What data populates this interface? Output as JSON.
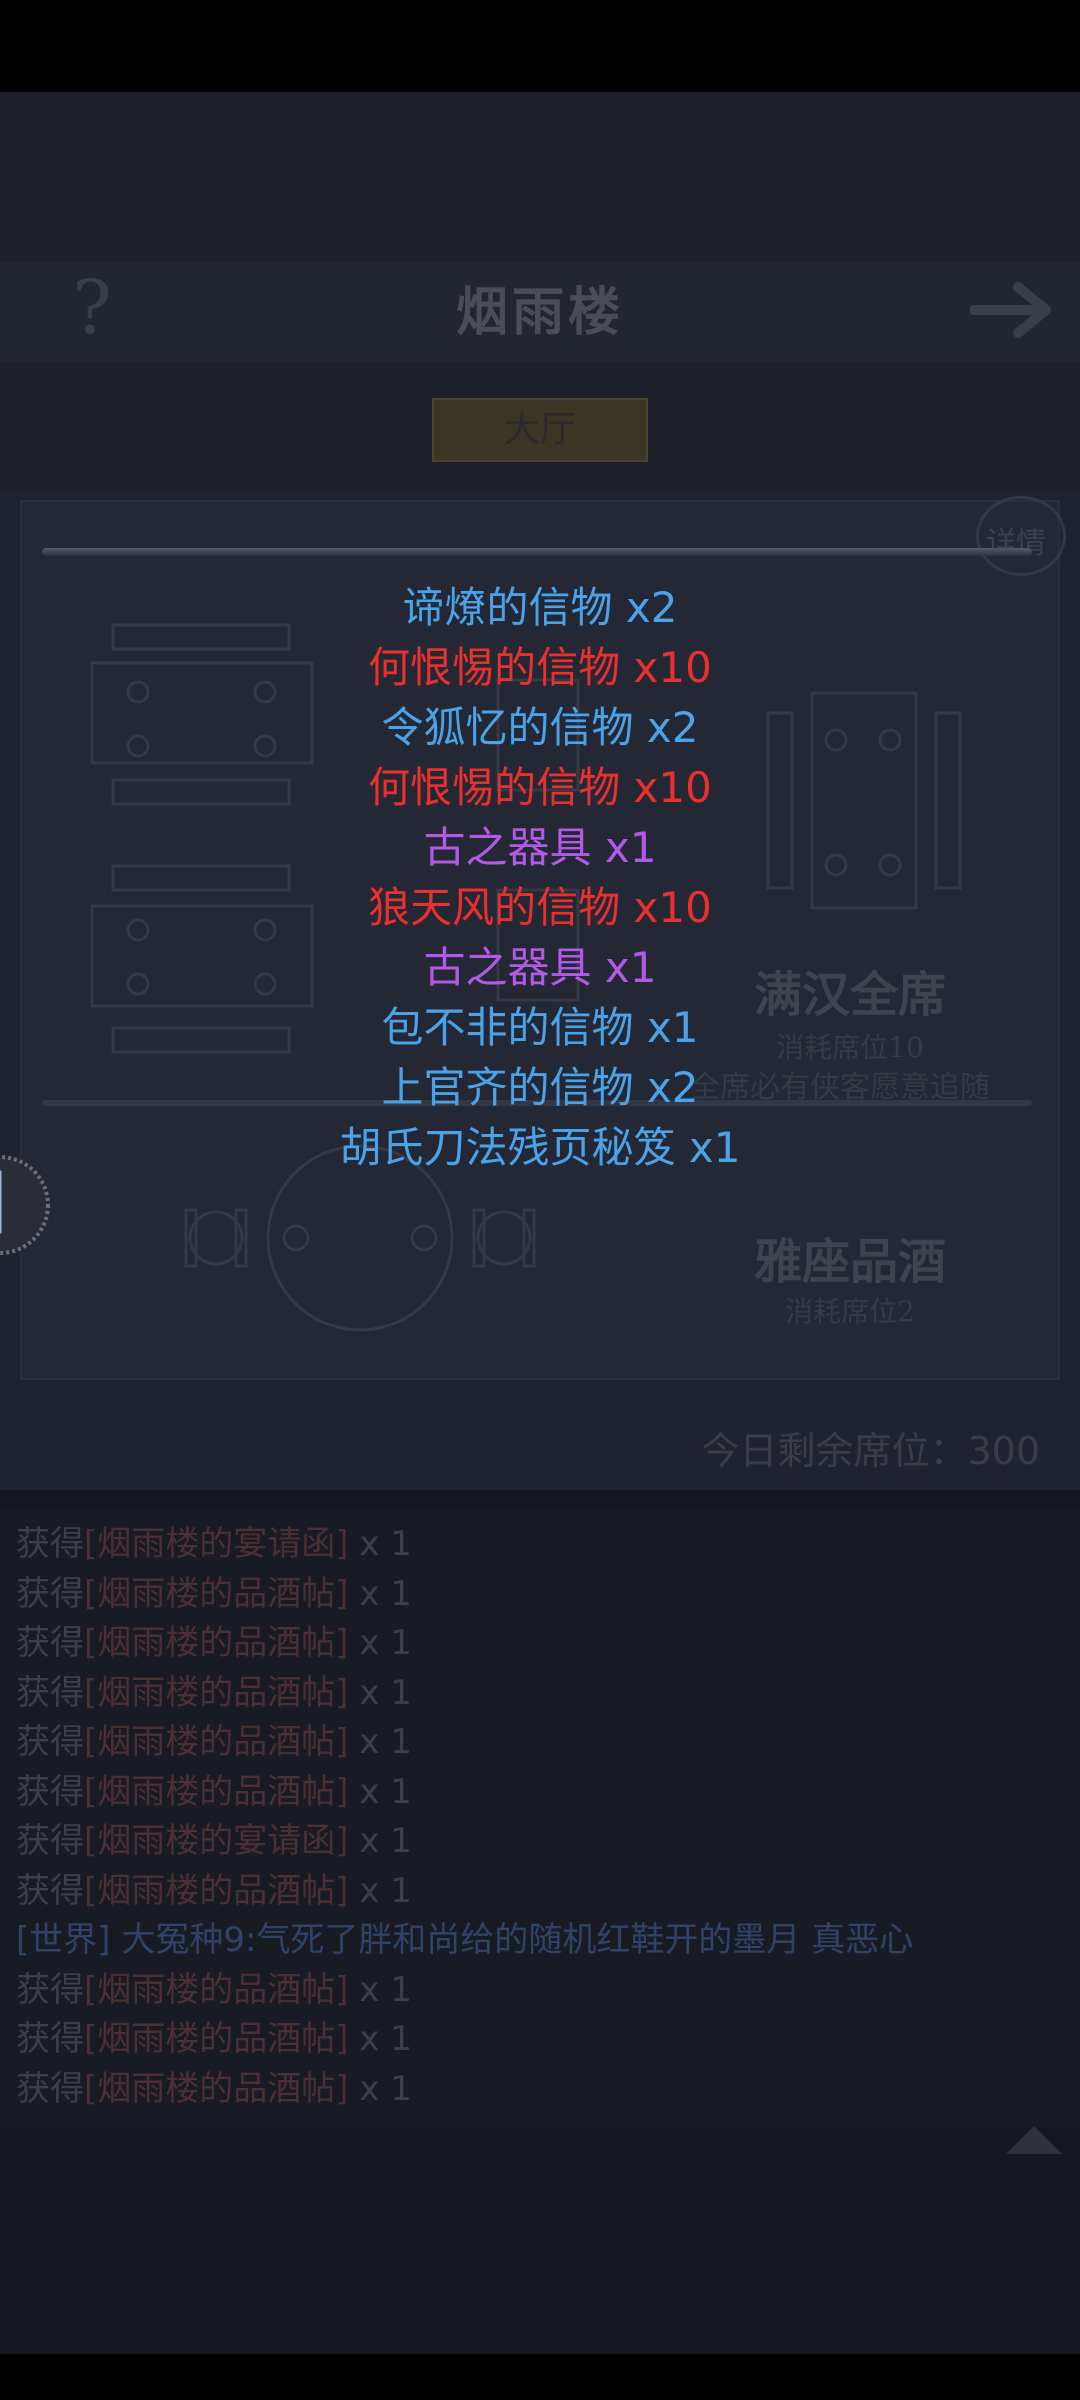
{
  "header": {
    "title": "烟雨楼",
    "help_icon": "question-mark-icon",
    "next_icon": "arrow-right-icon"
  },
  "tabs": {
    "hall": "大厅"
  },
  "panel": {
    "detail_label": "详情",
    "banquet": {
      "title": "满汉全席",
      "cost": "消耗席位10",
      "desc": "全席必有侠客愿意追随"
    },
    "wine": {
      "title": "雅座品酒",
      "cost": "消耗席位2"
    },
    "seats_remaining": "今日剩余席位：300"
  },
  "rewards": [
    {
      "text": "谛燎的信物 x2",
      "color": "#4aa3e8"
    },
    {
      "text": "何恨惕的信物 x10",
      "color": "#e8302f"
    },
    {
      "text": "令狐忆的信物 x2",
      "color": "#4aa3e8"
    },
    {
      "text": "何恨惕的信物 x10",
      "color": "#e8302f"
    },
    {
      "text": "古之器具 x1",
      "color": "#b259e8"
    },
    {
      "text": "狼天风的信物 x10",
      "color": "#e8302f"
    },
    {
      "text": "古之器具 x1",
      "color": "#b259e8"
    },
    {
      "text": "包不非的信物 x1",
      "color": "#4aa3e8"
    },
    {
      "text": "上官齐的信物 x2",
      "color": "#4aa3e8"
    },
    {
      "text": "胡氏刀法残页秘笈 x1",
      "color": "#4aa3e8"
    }
  ],
  "log": {
    "lines": [
      {
        "prefix": "获得",
        "item": "[烟雨楼的宴请函]",
        "suffix": " x 1"
      },
      {
        "prefix": "获得",
        "item": "[烟雨楼的品酒帖]",
        "suffix": " x 1"
      },
      {
        "prefix": "获得",
        "item": "[烟雨楼的品酒帖]",
        "suffix": " x 1"
      },
      {
        "prefix": "获得",
        "item": "[烟雨楼的品酒帖]",
        "suffix": " x 1"
      },
      {
        "prefix": "获得",
        "item": "[烟雨楼的品酒帖]",
        "suffix": " x 1"
      },
      {
        "prefix": "获得",
        "item": "[烟雨楼的品酒帖]",
        "suffix": " x 1"
      },
      {
        "prefix": "获得",
        "item": "[烟雨楼的宴请函]",
        "suffix": " x 1"
      },
      {
        "prefix": "获得",
        "item": "[烟雨楼的品酒帖]",
        "suffix": " x 1"
      },
      {
        "world": "[世界] 大冤种9:气死了胖和尚给的随机红鞋开的墨月 真恶心"
      },
      {
        "prefix": "获得",
        "item": "[烟雨楼的品酒帖]",
        "suffix": " x 1"
      },
      {
        "prefix": "获得",
        "item": "[烟雨楼的品酒帖]",
        "suffix": " x 1"
      },
      {
        "prefix": "获得",
        "item": "[烟雨楼的品酒帖]",
        "suffix": " x 1"
      }
    ],
    "scroll_icon": "triangle-up-icon"
  }
}
